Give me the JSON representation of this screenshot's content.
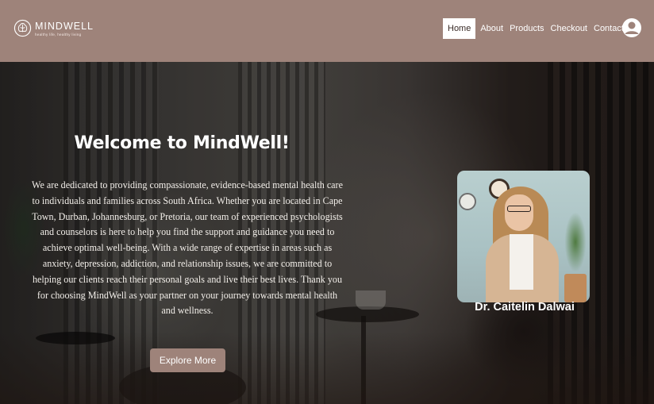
{
  "header": {
    "brand_name": "MINDWELL",
    "brand_tagline": "healthy life, healthy living",
    "nav": [
      {
        "label": "Home",
        "active": true
      },
      {
        "label": "About"
      },
      {
        "label": "Products"
      },
      {
        "label": "Checkout"
      },
      {
        "label": "Contact"
      }
    ],
    "account_icon": "user-circle-icon",
    "colors": {
      "header_bg": "#9e837a",
      "active_tab_bg": "#ffffff"
    }
  },
  "hero": {
    "heading": "Welcome to MindWell!",
    "intro": "We are dedicated to providing compassionate, evidence-based mental health care to individuals and families across South Africa. Whether you are located in Cape Town, Durban, Johannesburg, or Pretoria, our team of experienced psychologists and counselors is here to help you find the support and guidance you need to achieve optimal well-being. With a wide range of expertise in areas such as anxiety, depression, addiction, and relationship issues, we are committed to helping our clients reach their personal goals and live their best lives. Thank you for choosing MindWell as your partner on your journey towards mental health and wellness.",
    "cta_label": "Explore More",
    "doctor_name": "Dr. Caitelin Dalwai",
    "colors": {
      "cta_bg": "#9e837a"
    }
  }
}
